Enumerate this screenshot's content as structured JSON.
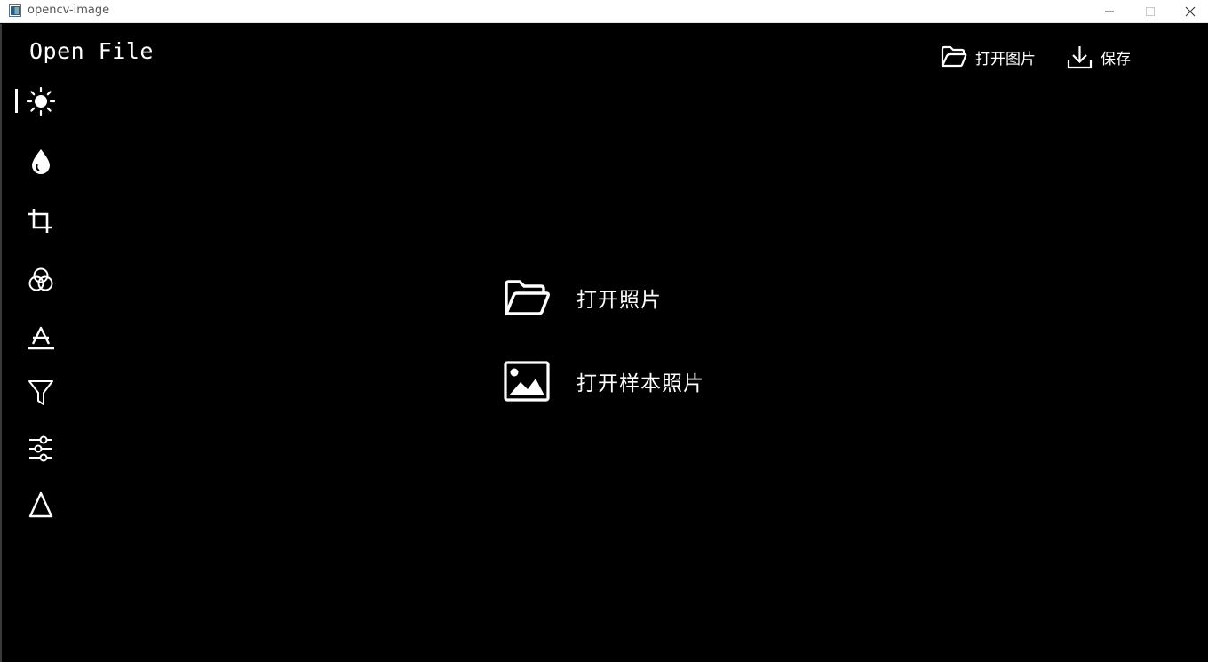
{
  "window": {
    "title": "opencv-image"
  },
  "header": {
    "title": "Open File",
    "open_image_label": "打开图片",
    "save_label": "保存"
  },
  "sidebar": {
    "items": [
      {
        "icon": "brightness-icon",
        "active": true
      },
      {
        "icon": "droplet-icon"
      },
      {
        "icon": "crop-icon"
      },
      {
        "icon": "color-circles-icon"
      },
      {
        "icon": "text-strike-icon"
      },
      {
        "icon": "filter-icon"
      },
      {
        "icon": "sliders-icon"
      },
      {
        "icon": "triangle-icon"
      }
    ]
  },
  "main": {
    "open_photo_label": "打开照片",
    "open_sample_label": "打开样本照片"
  },
  "colors": {
    "background": "#000000",
    "foreground": "#ffffff",
    "titlebar": "#ffffff"
  }
}
